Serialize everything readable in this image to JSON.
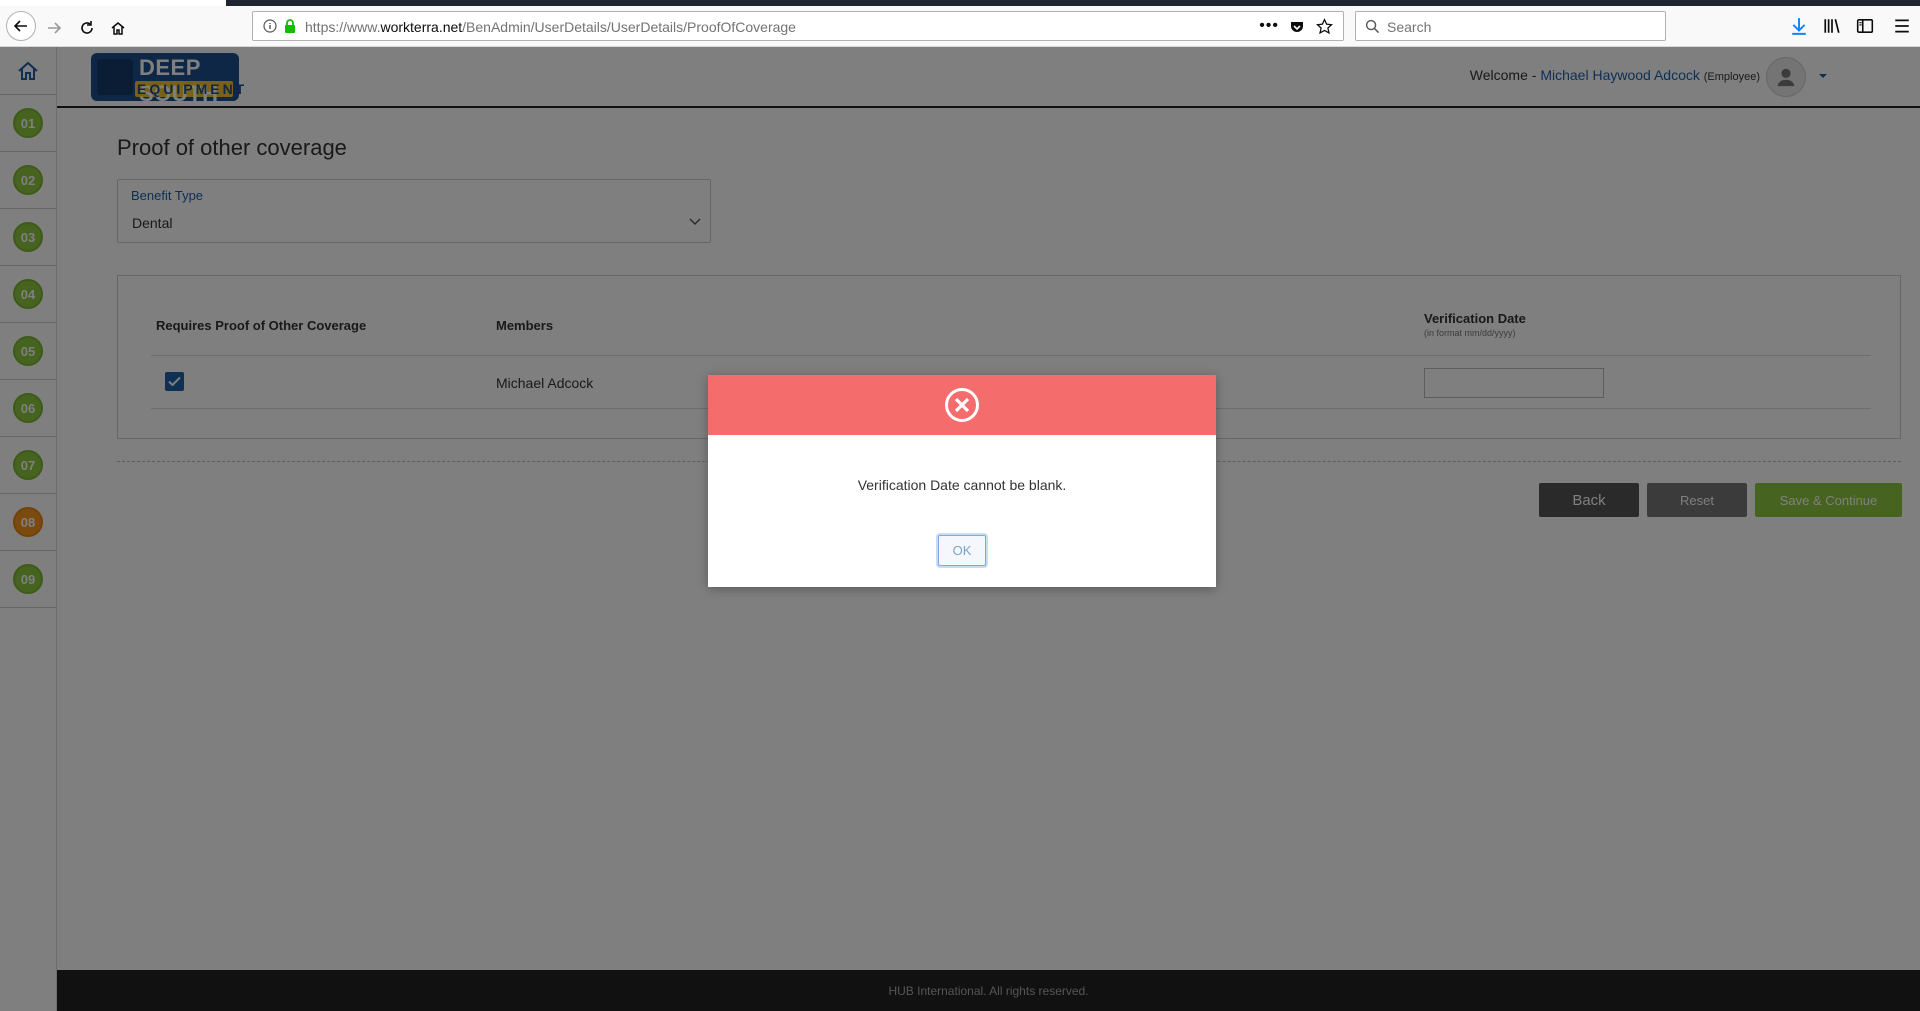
{
  "browser": {
    "url_prefix": "https://www.",
    "url_domain": "workterra.net",
    "url_path": "/BenAdmin/UserDetails/UserDetails/ProofOfCoverage",
    "search_placeholder": "Search"
  },
  "logo": {
    "top": "DEEP SOUTH",
    "bottom": "EQUIPMENT"
  },
  "header": {
    "welcome": "Welcome - ",
    "user_name": "Michael Haywood Adcock",
    "user_role": "(Employee)"
  },
  "sidebar": {
    "steps": [
      {
        "label": "01"
      },
      {
        "label": "02"
      },
      {
        "label": "03"
      },
      {
        "label": "04"
      },
      {
        "label": "05"
      },
      {
        "label": "06"
      },
      {
        "label": "07"
      },
      {
        "label": "08"
      },
      {
        "label": "09"
      }
    ],
    "active_step": "08"
  },
  "page": {
    "title": "Proof of other coverage",
    "benefit_type_label": "Benefit Type",
    "benefit_type_value": "Dental"
  },
  "table": {
    "col_requires": "Requires Proof of Other Coverage",
    "col_members": "Members",
    "col_verification": "Verification Date",
    "col_verification_hint": "(in format mm/dd/yyyy)",
    "rows": [
      {
        "checked": true,
        "member": "Michael Adcock",
        "verification_date": ""
      }
    ]
  },
  "buttons": {
    "back": "Back",
    "reset": "Reset",
    "save": "Save & Continue"
  },
  "footer": {
    "text": "HUB International. All rights reserved."
  },
  "modal": {
    "message": "Verification Date cannot be blank.",
    "ok": "OK",
    "header_color": "#f46c6c"
  },
  "colors": {
    "accent": "#1f5fa6",
    "step_green": "#8dc63f",
    "step_active": "#f7941d"
  }
}
